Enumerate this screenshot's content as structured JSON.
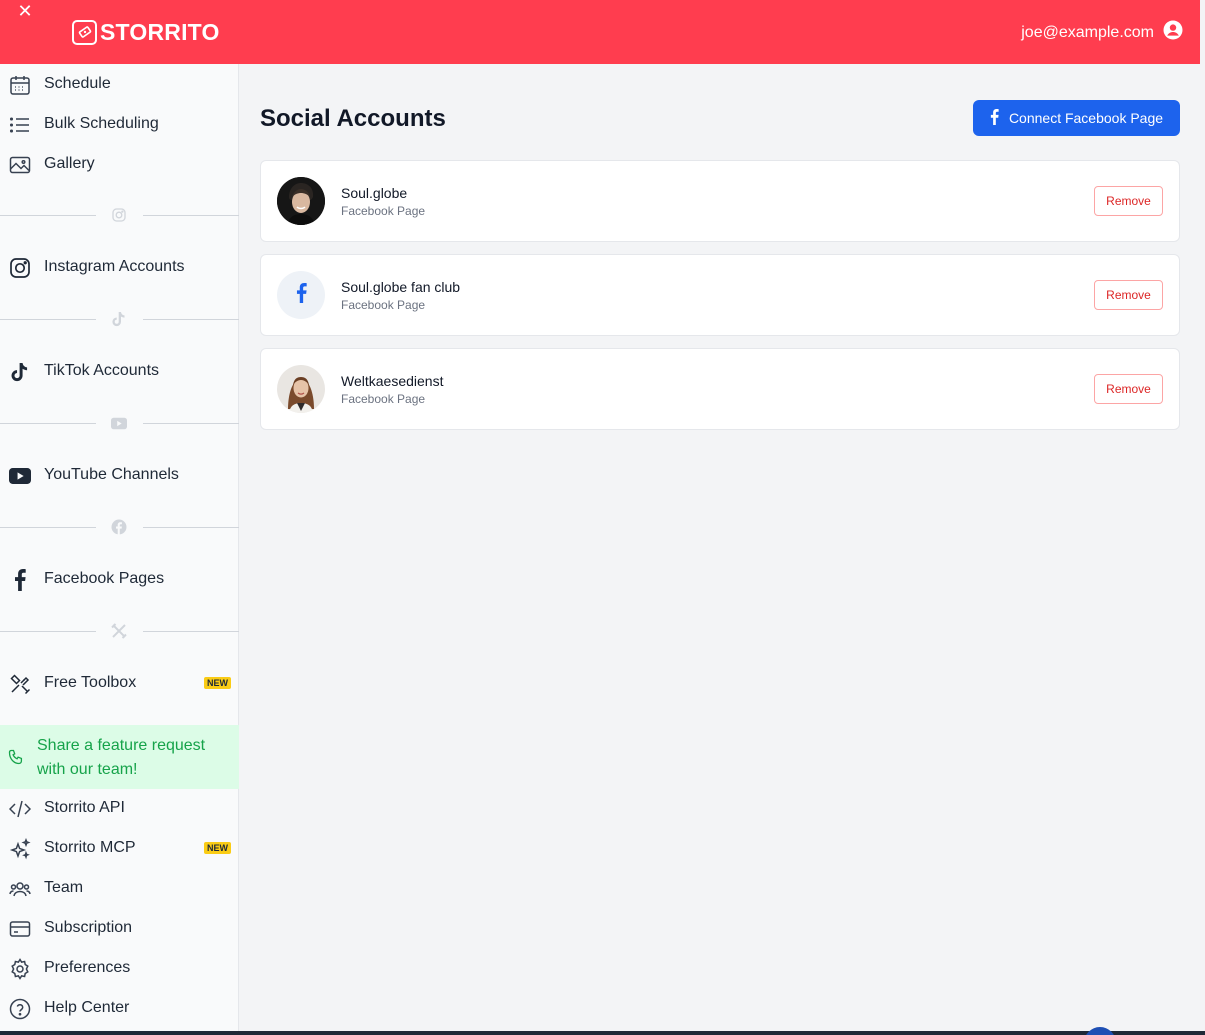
{
  "header": {
    "brand": "STORRITO",
    "user_email": "joe@example.com",
    "background": "#ff3d4f"
  },
  "sidebar": {
    "items_top": [
      {
        "label": "Schedule",
        "icon": "calendar-icon"
      },
      {
        "label": "Bulk Scheduling",
        "icon": "list-icon"
      },
      {
        "label": "Gallery",
        "icon": "image-icon"
      }
    ],
    "instagram": "Instagram Accounts",
    "tiktok": "TikTok Accounts",
    "youtube": "YouTube Channels",
    "facebook": "Facebook Pages",
    "toolbox": "Free Toolbox",
    "new_badge": "NEW",
    "feature_request": "Share a feature request with our team!",
    "items_bottom": [
      {
        "label": "Storrito API",
        "icon": "code-icon"
      },
      {
        "label": "Storrito MCP",
        "icon": "sparkles-icon",
        "badge": "NEW"
      },
      {
        "label": "Team",
        "icon": "users-icon"
      },
      {
        "label": "Subscription",
        "icon": "credit-card-icon"
      },
      {
        "label": "Preferences",
        "icon": "gear-icon"
      },
      {
        "label": "Help Center",
        "icon": "help-circle-icon"
      }
    ]
  },
  "main": {
    "title": "Social Accounts",
    "connect_button": "Connect Facebook Page",
    "accent": "#1d63ed",
    "accounts": [
      {
        "name": "Soul.globe",
        "type": "Facebook Page",
        "remove": "Remove"
      },
      {
        "name": "Soul.globe fan club",
        "type": "Facebook Page",
        "remove": "Remove"
      },
      {
        "name": "Weltkaesedienst",
        "type": "Facebook Page",
        "remove": "Remove"
      }
    ]
  }
}
